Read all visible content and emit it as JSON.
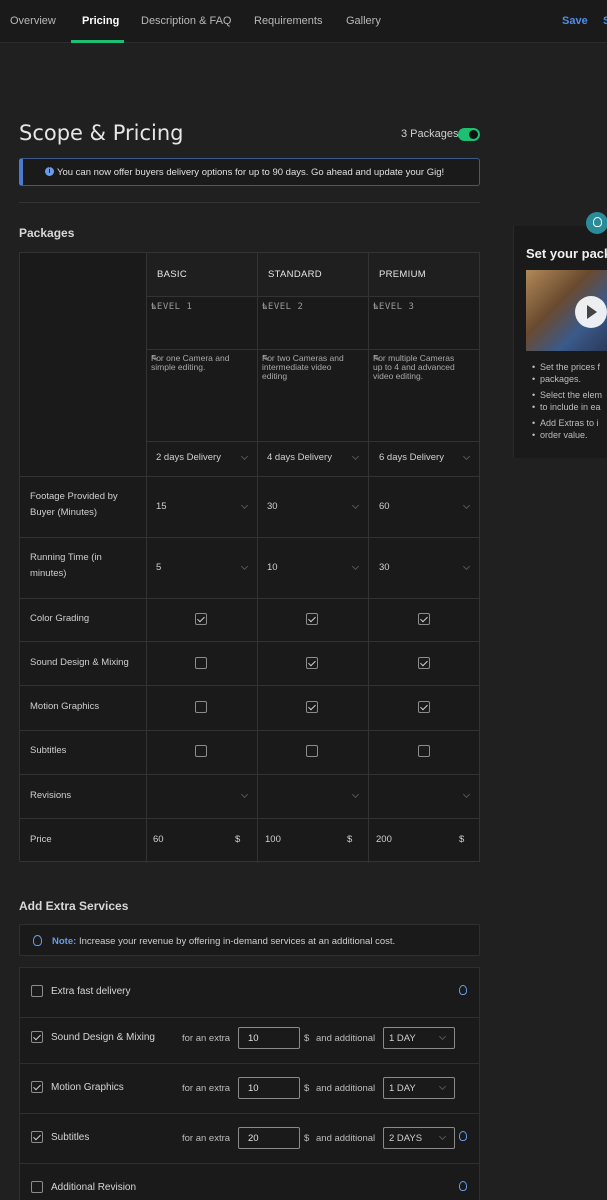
{
  "nav": {
    "tabs": [
      "Overview",
      "Pricing",
      "Description & FAQ",
      "Requirements",
      "Gallery"
    ],
    "active_tab": "Pricing",
    "save_label": "Save",
    "save_next_label": "S"
  },
  "page": {
    "title": "Scope & Pricing",
    "packages_toggle_label": "3 Packages",
    "packages_toggle_on": true
  },
  "banner": {
    "text": "You can now offer buyers delivery options for up to 90 days. Go ahead and update your Gig!"
  },
  "packages": {
    "section_title": "Packages",
    "columns": [
      {
        "name": "BASIC",
        "level": "LEVEL 1",
        "description": "For one Camera and simple editing.",
        "delivery": "2 days Delivery",
        "footage": "15",
        "running_time": "5",
        "color_grading": true,
        "sound_design": false,
        "motion_graphics": false,
        "subtitles": false,
        "revisions": "",
        "price": "60"
      },
      {
        "name": "STANDARD",
        "level": "LEVEL 2",
        "description": "For two Cameras and intermediate video editing",
        "delivery": "4 days Delivery",
        "footage": "30",
        "running_time": "10",
        "color_grading": true,
        "sound_design": true,
        "motion_graphics": true,
        "subtitles": false,
        "revisions": "",
        "price": "100"
      },
      {
        "name": "PREMIUM",
        "level": "LEVEL 3",
        "description": "For multiple Cameras up to 4 and advanced video editing.",
        "delivery": "6 days Delivery",
        "footage": "60",
        "running_time": "30",
        "color_grading": true,
        "sound_design": true,
        "motion_graphics": true,
        "subtitles": false,
        "revisions": "",
        "price": "200"
      }
    ],
    "row_labels": {
      "footage": "Footage Provided by Buyer (Minutes)",
      "running_time": "Running Time (in minutes)",
      "color_grading": "Color Grading",
      "sound_design": "Sound Design & Mixing",
      "motion_graphics": "Motion Graphics",
      "subtitles": "Subtitles",
      "revisions": "Revisions",
      "price": "Price"
    },
    "currency": "$"
  },
  "sidebar": {
    "title": "Set your pack",
    "tips": [
      "Set the prices f",
      "packages.",
      "Select the elem",
      "to include in ea",
      "Add Extras to i",
      "order value."
    ]
  },
  "extras": {
    "section_title": "Add Extra Services",
    "note_label": "Note:",
    "note_text": "Increase your revenue by offering in-demand services at an additional cost.",
    "for_an_extra": "for an extra",
    "and_additional": "and additional",
    "currency": "$",
    "items": [
      {
        "name": "Extra fast delivery",
        "checked": false,
        "amount": "",
        "days": "",
        "tip": true
      },
      {
        "name": "Sound Design & Mixing",
        "checked": true,
        "amount": "10",
        "days": "1 DAY",
        "tip": false
      },
      {
        "name": "Motion Graphics",
        "checked": true,
        "amount": "10",
        "days": "1 DAY",
        "tip": false
      },
      {
        "name": "Subtitles",
        "checked": true,
        "amount": "20",
        "days": "2 DAYS",
        "tip": true
      },
      {
        "name": "Additional Revision",
        "checked": false,
        "amount": "",
        "days": "",
        "tip": true
      }
    ]
  }
}
